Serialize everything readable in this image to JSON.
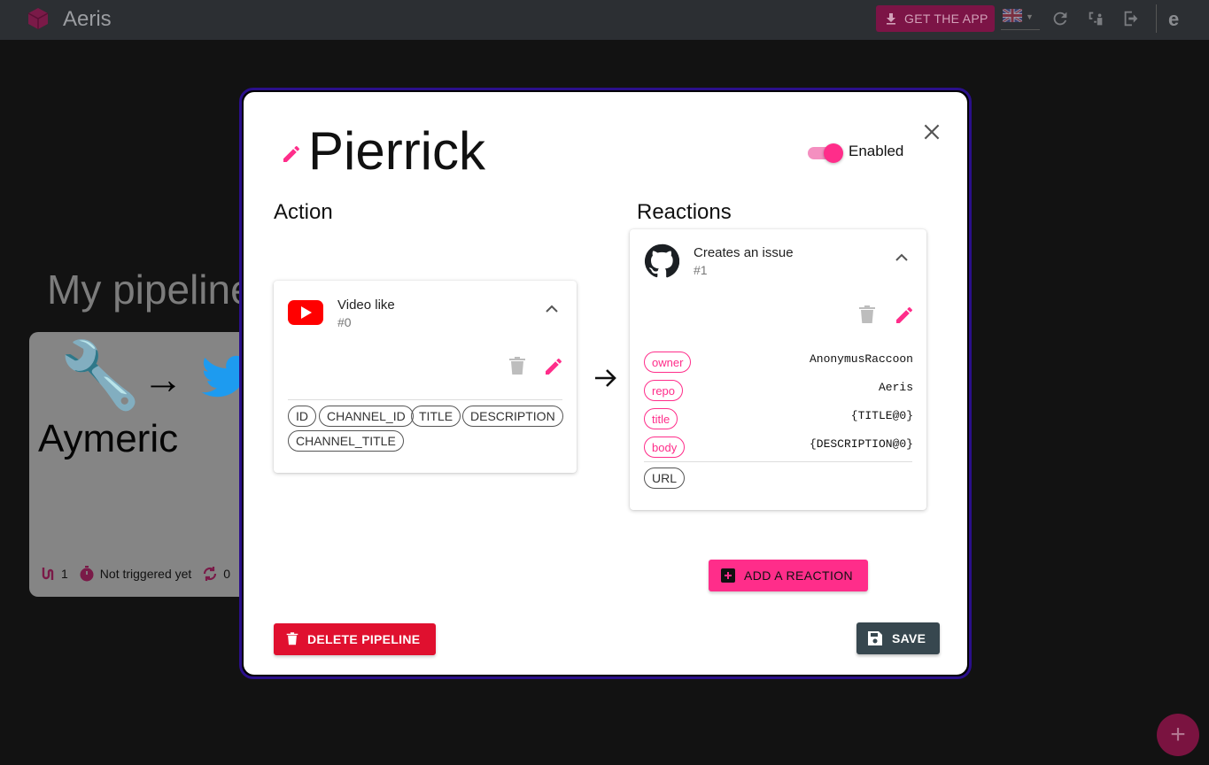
{
  "app": {
    "brand": "Aeris",
    "get_app_label": "GET THE APP",
    "avatar_letter": "e"
  },
  "topbar_icons": [
    "refresh-icon",
    "service-plug-icon",
    "logout-icon"
  ],
  "background": {
    "page_title": "My pipelines",
    "card": {
      "name": "Aymeric",
      "action_icon": "wrench-icon",
      "reaction_icon": "twitter-icon",
      "reactions_count": "1",
      "last_trigger": "Not triggered yet",
      "trigger_count": "0"
    },
    "fab_label": "+"
  },
  "modal": {
    "pipeline_name": "Pierrick",
    "toggle_label": "Enabled",
    "toggle_on": true,
    "action_heading": "Action",
    "reactions_heading": "Reactions",
    "action": {
      "service_icon": "youtube-icon",
      "title": "Video like",
      "index": "#0",
      "outputs": [
        "ID",
        "CHANNEL_ID",
        "TITLE",
        "DESCRIPTION",
        "CHANNEL_TITLE"
      ]
    },
    "reaction": {
      "service_icon": "github-icon",
      "title": "Creates an issue",
      "index": "#1",
      "params": [
        {
          "key": "owner",
          "value": "AnonymusRaccoon"
        },
        {
          "key": "repo",
          "value": "Aeris"
        },
        {
          "key": "title",
          "value": "{TITLE@0}"
        },
        {
          "key": "body",
          "value": "{DESCRIPTION@0}"
        }
      ],
      "outputs": [
        "URL"
      ]
    },
    "add_reaction_label": "ADD A REACTION",
    "delete_label": "DELETE PIPELINE",
    "save_label": "SAVE"
  },
  "colors": {
    "accent_pink": "#ff2d8a",
    "danger_red": "#e0102f",
    "save_dark": "#37474f",
    "youtube_red": "#ff0000",
    "twitter_blue": "#1d9bf0",
    "modal_border": "#2a0f8a"
  }
}
